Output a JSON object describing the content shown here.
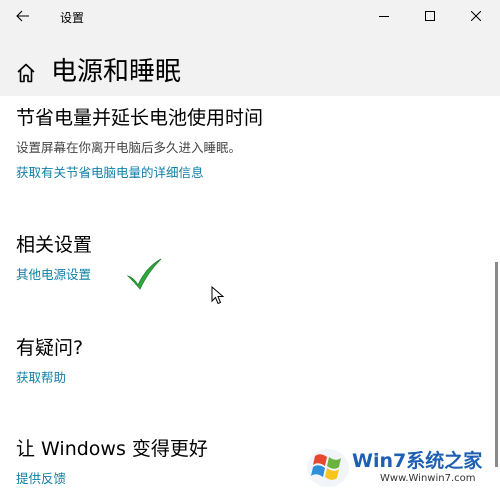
{
  "window": {
    "app_title": "设置",
    "back_icon": "arrow-left-icon",
    "controls": [
      "minimize-icon",
      "maximize-icon",
      "close-icon"
    ]
  },
  "page": {
    "title": "电源和睡眠",
    "title_icon": "home-icon"
  },
  "sections": {
    "battery": {
      "heading": "节省电量并延长电池使用时间",
      "description": "设置屏幕在你离开电脑后多久进入睡眠。",
      "link": "获取有关节省电脑电量的详细信息"
    },
    "related": {
      "heading": "相关设置",
      "link": "其他电源设置"
    },
    "questions": {
      "heading": "有疑问?",
      "link": "获取帮助"
    },
    "improve": {
      "heading": "让 Windows 变得更好",
      "link": "提供反馈"
    }
  },
  "annotations": {
    "checkmark_icon": "green-checkmark-icon",
    "cursor_icon": "mouse-pointer-icon"
  },
  "watermark": {
    "logo_icon": "windows-flag-logo-icon",
    "text": "Win7系统之家",
    "url": "Www.Winwin7.com"
  },
  "colors": {
    "link": "#0f7fa7",
    "header_bg": "#f2f2f2",
    "checkmark": "#2fa93f"
  }
}
